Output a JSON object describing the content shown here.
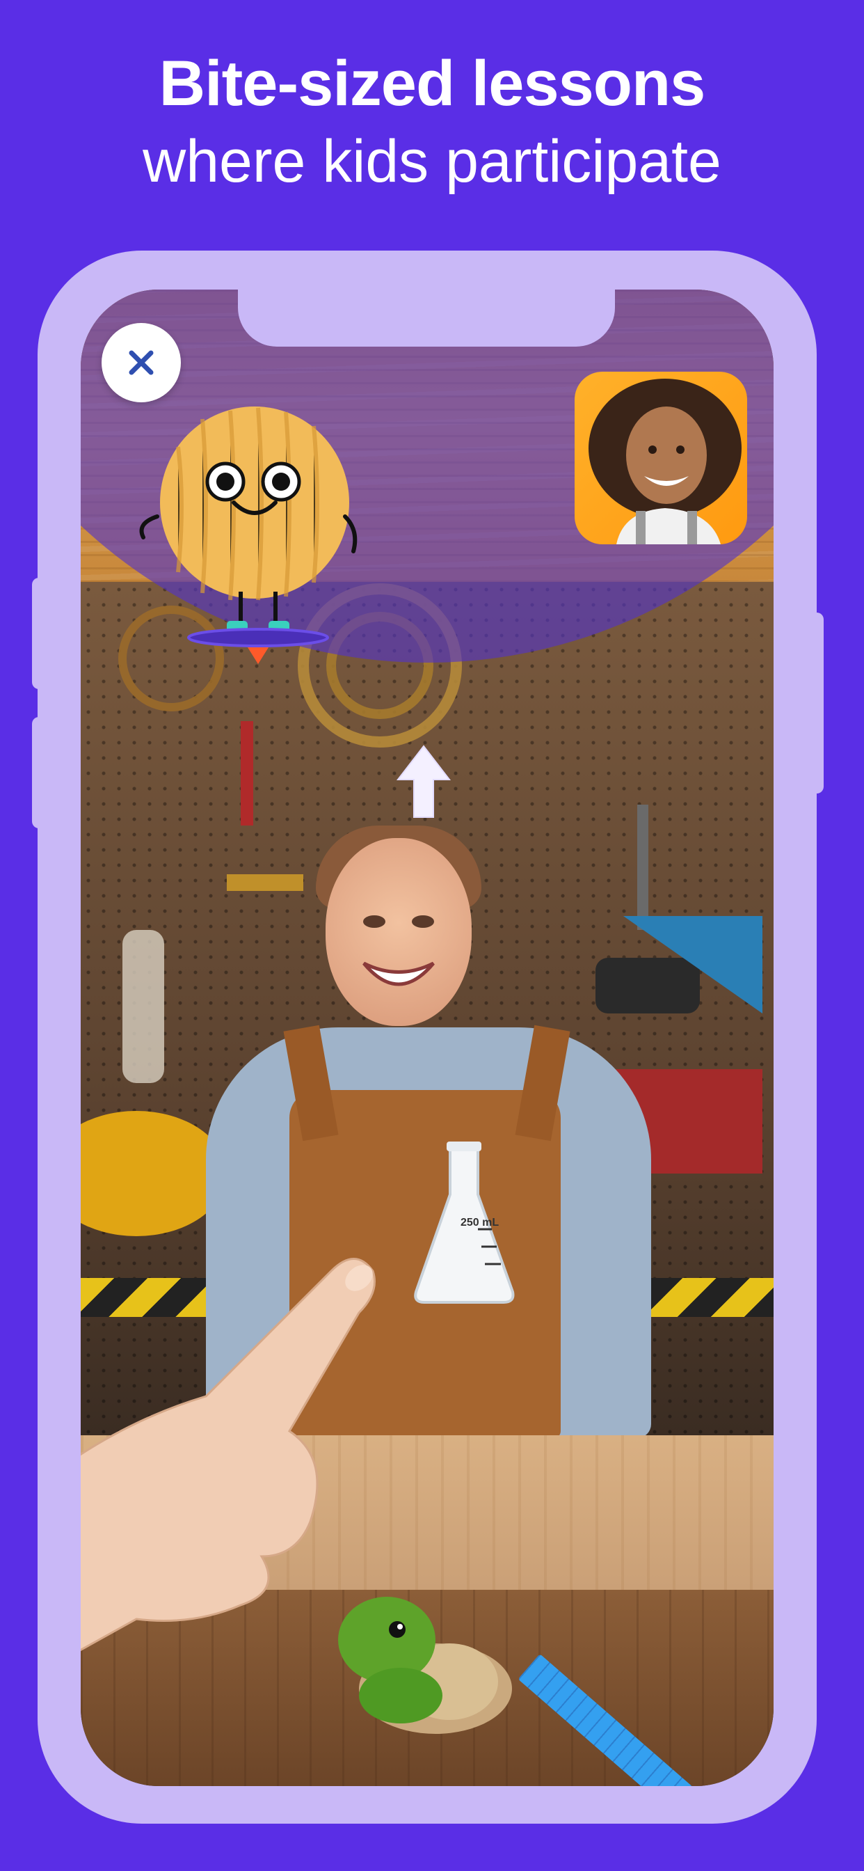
{
  "headline": {
    "line1": "Bite-sized lessons",
    "line2": "where kids participate"
  },
  "colors": {
    "background": "#5a2ee6",
    "phone_frame": "#c9b8f7",
    "overlay_dome": "#5334c8",
    "selfview_bg": "#ff9a10"
  },
  "icons": {
    "close": "close-icon",
    "swipe_up": "arrow-up-icon"
  },
  "flask": {
    "label": "250 mL"
  }
}
